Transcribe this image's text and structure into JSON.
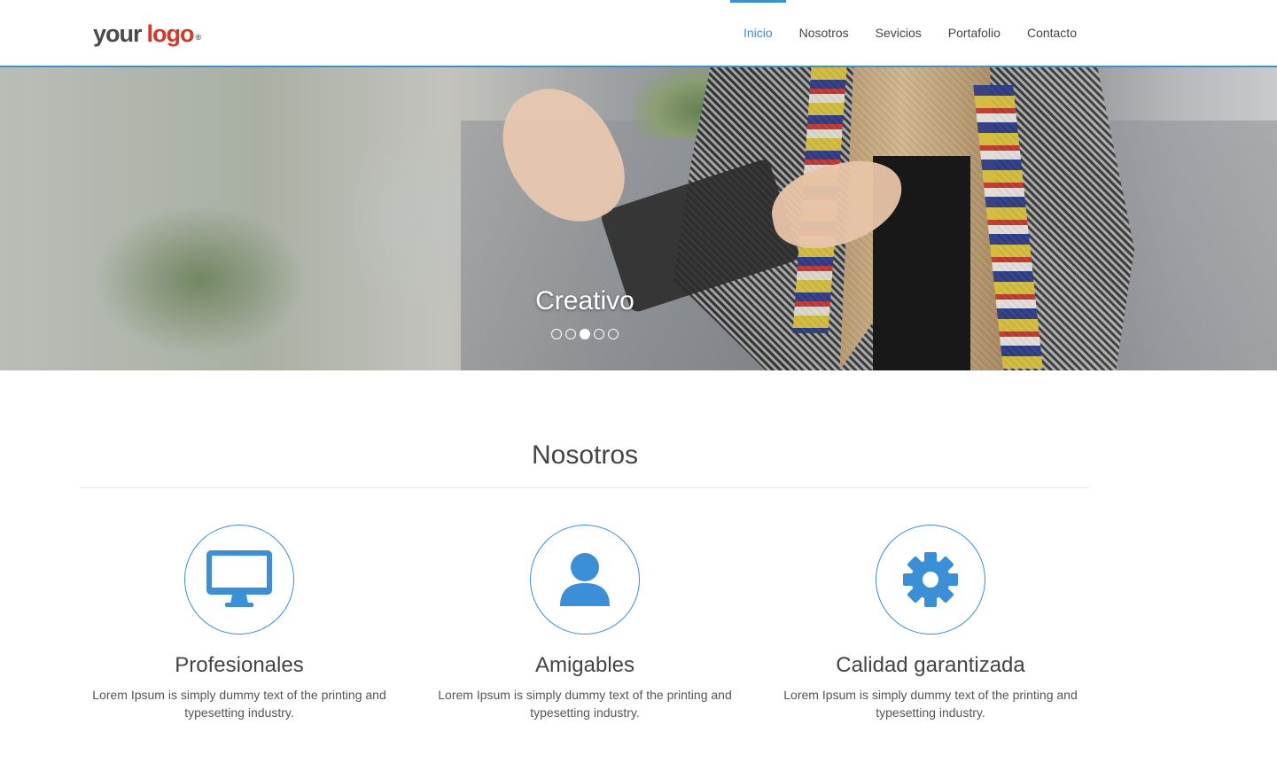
{
  "logo": {
    "part1": "your",
    "part2": "logo",
    "mark": "®"
  },
  "nav": {
    "items": [
      {
        "label": "Inicio",
        "active": true
      },
      {
        "label": "Nosotros",
        "active": false
      },
      {
        "label": "Sevicios",
        "active": false
      },
      {
        "label": "Portafolio",
        "active": false
      },
      {
        "label": "Contacto",
        "active": false
      }
    ]
  },
  "hero": {
    "caption": "Creativo",
    "slides_total": 5,
    "active_slide": 3
  },
  "section": {
    "title": "Nosotros",
    "features": [
      {
        "icon": "monitor-icon",
        "title": "Profesionales",
        "text": "Lorem Ipsum is simply dummy text of the printing and typesetting industry."
      },
      {
        "icon": "user-icon",
        "title": "Amigables",
        "text": "Lorem Ipsum is simply dummy text of the printing and typesetting industry."
      },
      {
        "icon": "gear-icon",
        "title": "Calidad garantizada",
        "text": "Lorem Ipsum is simply dummy text of the printing and typesetting industry."
      }
    ]
  },
  "colors": {
    "accent": "#3a8fd6",
    "logo_red": "#d2392b",
    "text": "#444444"
  }
}
